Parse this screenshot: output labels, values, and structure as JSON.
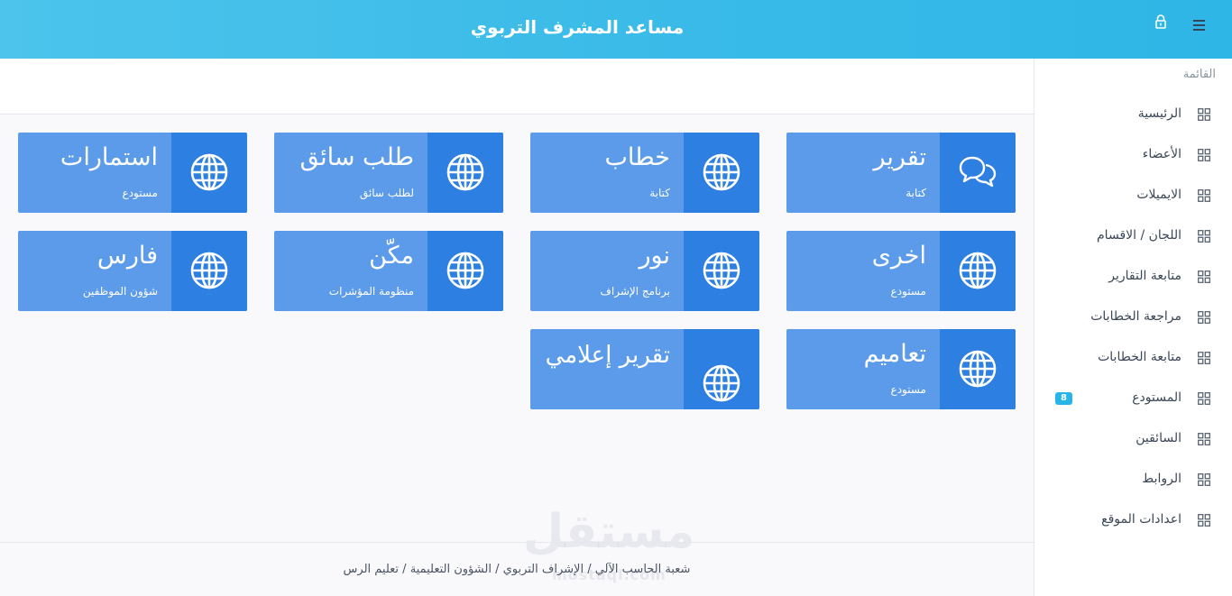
{
  "header": {
    "title": "مساعد المشرف التربوي",
    "menu_icon": "hamburger-icon",
    "lock_icon": "lock-icon"
  },
  "sidebar": {
    "heading": "القائمة",
    "items": [
      {
        "label": "الرئيسية"
      },
      {
        "label": "الأعضاء"
      },
      {
        "label": "الايميلات"
      },
      {
        "label": "اللجان / الاقسام"
      },
      {
        "label": "متابعة التقارير"
      },
      {
        "label": "مراجعة الخطابات"
      },
      {
        "label": "متابعة الخطابات"
      },
      {
        "label": "المستودع",
        "badge": "8"
      },
      {
        "label": "السائقين"
      },
      {
        "label": "الروابط"
      },
      {
        "label": "اعدادات الموقع"
      }
    ]
  },
  "cards": [
    {
      "title": "تقرير",
      "subtitle": "كتابة",
      "icon": "chat-bubbles-icon"
    },
    {
      "title": "خطاب",
      "subtitle": "كتابة",
      "icon": "globe-icon"
    },
    {
      "title": "طلب سائق",
      "subtitle": "لطلب سائق",
      "icon": "globe-icon"
    },
    {
      "title": "استمارات",
      "subtitle": "مستودع",
      "icon": "globe-icon"
    },
    {
      "title": "اخرى",
      "subtitle": "مستودع",
      "icon": "globe-icon"
    },
    {
      "title": "نور",
      "subtitle": "برنامج الإشراف",
      "icon": "globe-icon"
    },
    {
      "title": "مكّن",
      "subtitle": "منظومة المؤشرات",
      "icon": "globe-icon"
    },
    {
      "title": "فارس",
      "subtitle": "شؤون الموظفين",
      "icon": "globe-icon"
    },
    {
      "title": "تعاميم",
      "subtitle": "مستودع",
      "icon": "globe-icon"
    },
    {
      "title": "تقرير إعلامي",
      "subtitle": "",
      "icon": "globe-icon"
    }
  ],
  "footer": {
    "breadcrumb": "شعبة الحاسب الآلي / الإشراف التربوي / الشؤون التعليمية / تعليم الرس"
  },
  "watermark": {
    "text": "مستقل",
    "sub": "mostaql.com"
  },
  "colors": {
    "header": "#3bbbe8",
    "card": "#5c9bea",
    "card_icon_box": "#2d7fe2",
    "badge": "#27b4e8"
  }
}
